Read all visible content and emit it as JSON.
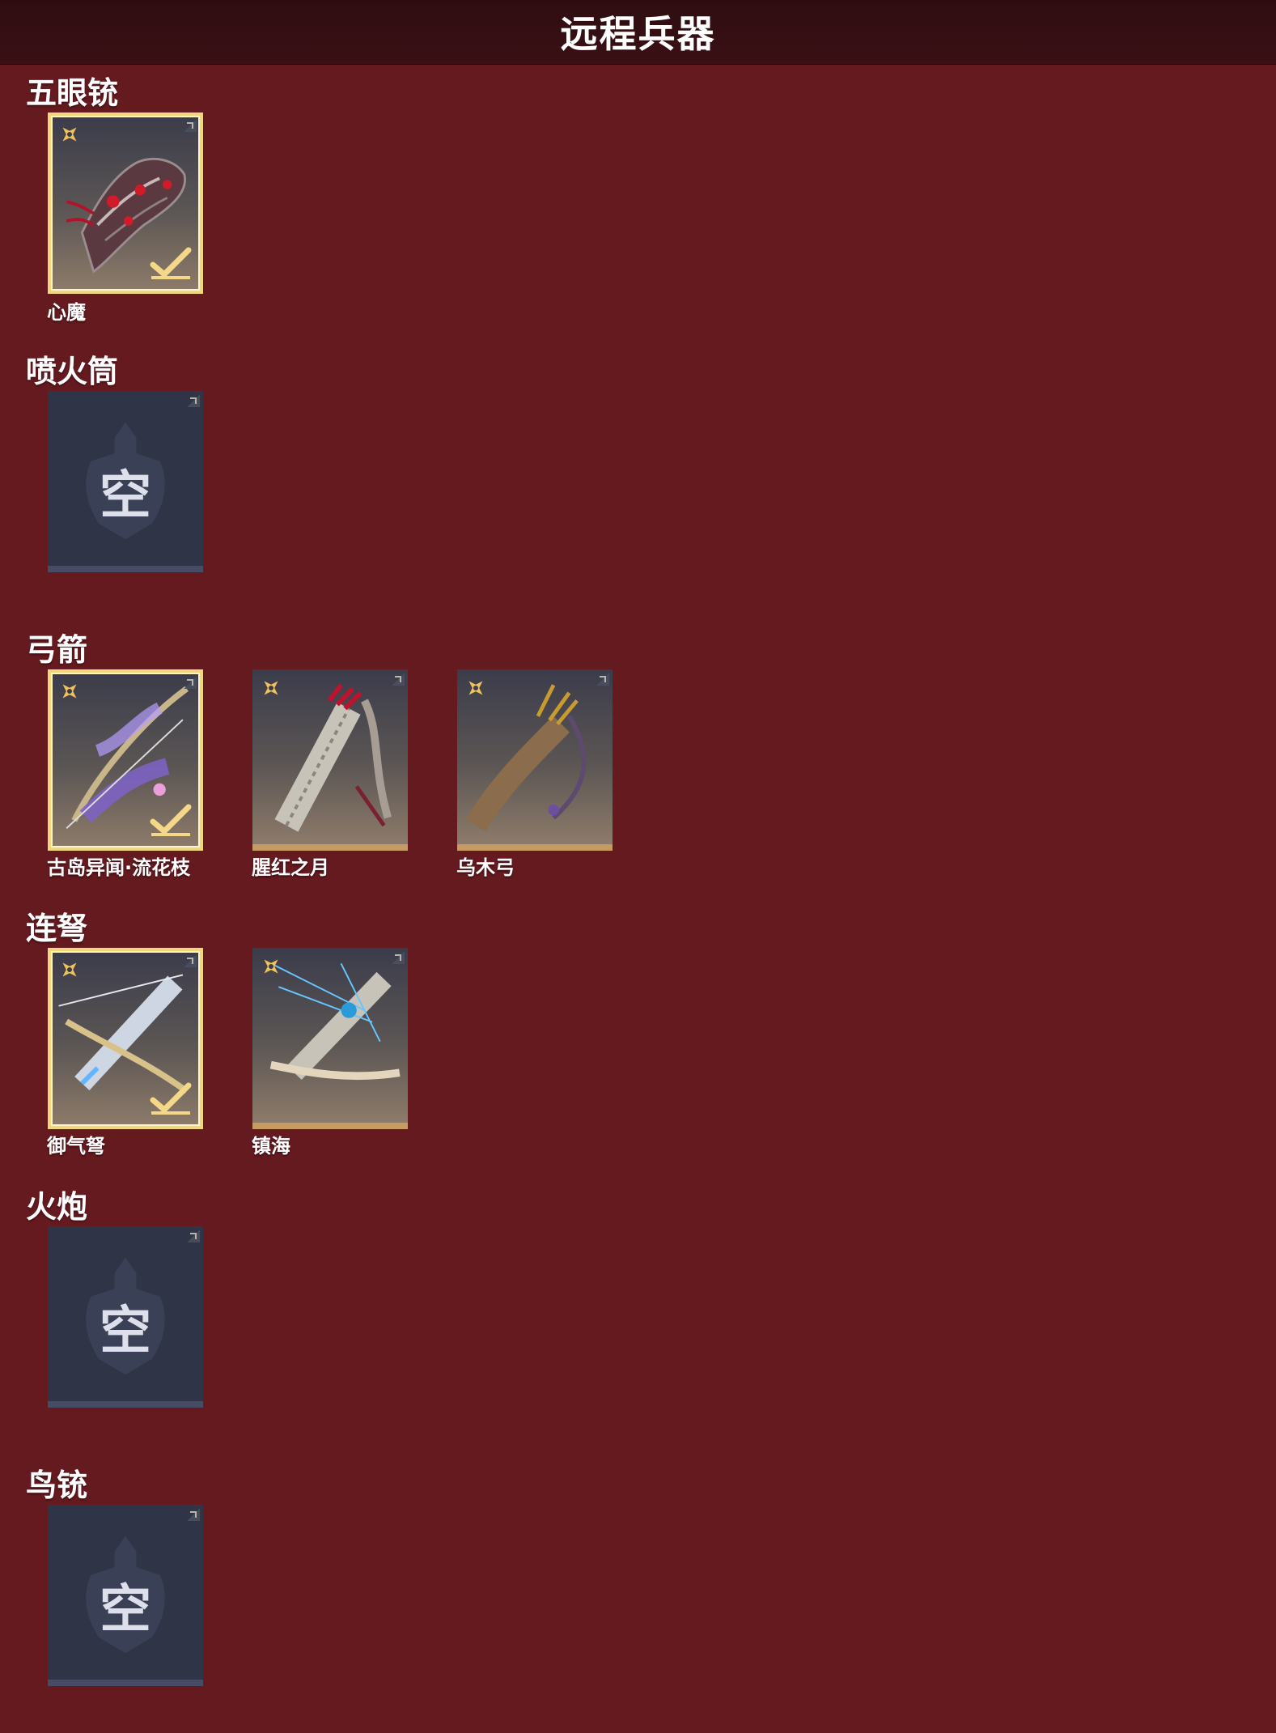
{
  "header": {
    "title": "远程兵器"
  },
  "sections": [
    {
      "title": "五眼铳",
      "items": [
        {
          "name": "心魔",
          "state": "equipped"
        }
      ]
    },
    {
      "title": "喷火筒",
      "items": [
        {
          "empty_label": "空",
          "state": "empty"
        }
      ]
    },
    {
      "title": "弓箭",
      "items": [
        {
          "name": "古岛异闻·流花枝",
          "state": "equipped"
        },
        {
          "name": "腥红之月",
          "state": "owned"
        },
        {
          "name": "乌木弓",
          "state": "owned"
        }
      ]
    },
    {
      "title": "连弩",
      "items": [
        {
          "name": "御气弩",
          "state": "equipped"
        },
        {
          "name": "镇海",
          "state": "owned"
        }
      ]
    },
    {
      "title": "火炮",
      "items": [
        {
          "empty_label": "空",
          "state": "empty"
        }
      ]
    },
    {
      "title": "鸟铳",
      "items": [
        {
          "empty_label": "空",
          "state": "empty"
        }
      ]
    }
  ],
  "colors": {
    "background": "#651a1f",
    "header_background": "#2e0d10",
    "selected_border": "#f2d67e",
    "rarity_gold": "#f0c35a",
    "empty_card": "#2f3447"
  },
  "icons": {
    "rarity": "shuriken-rarity-icon",
    "equipped": "checkmark-icon",
    "corner": "corner-tag-icon",
    "empty": "helmet-emblem-icon"
  }
}
